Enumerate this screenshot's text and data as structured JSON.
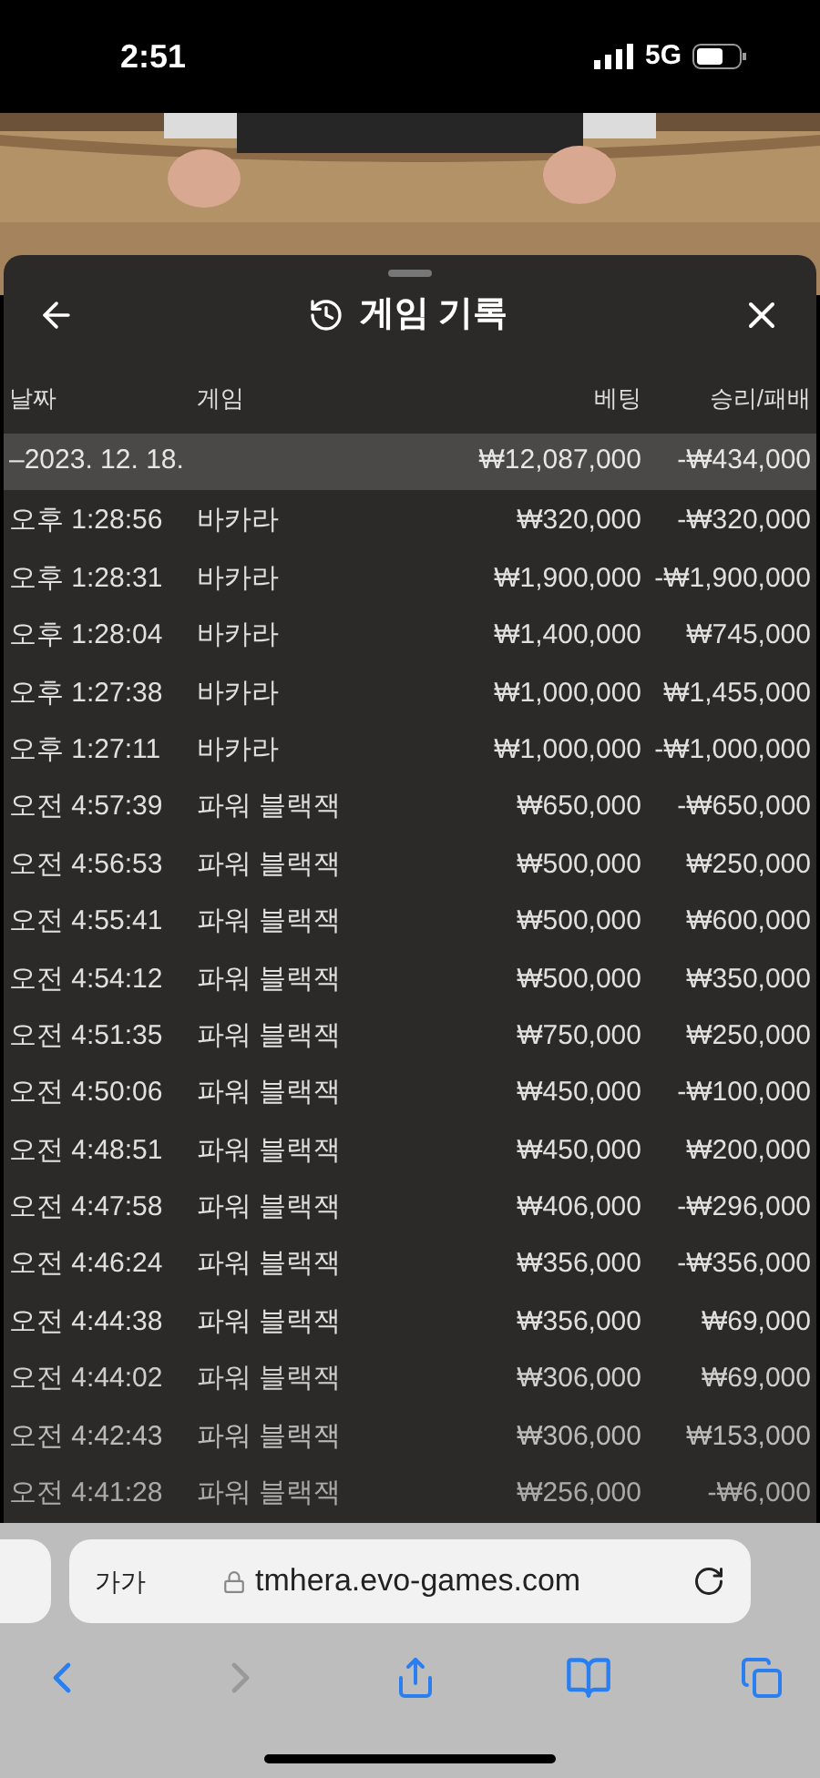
{
  "status_bar": {
    "time": "2:51",
    "network": "5G"
  },
  "sheet": {
    "title": "게임 기록"
  },
  "table": {
    "columns": [
      "날짜",
      "게임",
      "베팅",
      "승리/패배"
    ],
    "summary": {
      "date": "–2023. 12. 18.",
      "bet": "₩12,087,000",
      "result": "-₩434,000"
    },
    "rows": [
      {
        "time": "오후 1:28:56",
        "game": "바카라",
        "bet": "₩320,000",
        "result": "-₩320,000"
      },
      {
        "time": "오후 1:28:31",
        "game": "바카라",
        "bet": "₩1,900,000",
        "result": "-₩1,900,000"
      },
      {
        "time": "오후 1:28:04",
        "game": "바카라",
        "bet": "₩1,400,000",
        "result": "₩745,000"
      },
      {
        "time": "오후 1:27:38",
        "game": "바카라",
        "bet": "₩1,000,000",
        "result": "₩1,455,000"
      },
      {
        "time": "오후 1:27:11",
        "game": "바카라",
        "bet": "₩1,000,000",
        "result": "-₩1,000,000"
      },
      {
        "time": "오전 4:57:39",
        "game": "파워 블랙잭",
        "bet": "₩650,000",
        "result": "-₩650,000"
      },
      {
        "time": "오전 4:56:53",
        "game": "파워 블랙잭",
        "bet": "₩500,000",
        "result": "₩250,000"
      },
      {
        "time": "오전 4:55:41",
        "game": "파워 블랙잭",
        "bet": "₩500,000",
        "result": "₩600,000"
      },
      {
        "time": "오전 4:54:12",
        "game": "파워 블랙잭",
        "bet": "₩500,000",
        "result": "₩350,000"
      },
      {
        "time": "오전 4:51:35",
        "game": "파워 블랙잭",
        "bet": "₩750,000",
        "result": "₩250,000"
      },
      {
        "time": "오전 4:50:06",
        "game": "파워 블랙잭",
        "bet": "₩450,000",
        "result": "-₩100,000"
      },
      {
        "time": "오전 4:48:51",
        "game": "파워 블랙잭",
        "bet": "₩450,000",
        "result": "₩200,000"
      },
      {
        "time": "오전 4:47:58",
        "game": "파워 블랙잭",
        "bet": "₩406,000",
        "result": "-₩296,000"
      },
      {
        "time": "오전 4:46:24",
        "game": "파워 블랙잭",
        "bet": "₩356,000",
        "result": "-₩356,000"
      },
      {
        "time": "오전 4:44:38",
        "game": "파워 블랙잭",
        "bet": "₩356,000",
        "result": "₩69,000"
      },
      {
        "time": "오전 4:44:02",
        "game": "파워 블랙잭",
        "bet": "₩306,000",
        "result": "₩69,000"
      },
      {
        "time": "오전 4:42:43",
        "game": "파워 블랙잭",
        "bet": "₩306,000",
        "result": "₩153,000"
      },
      {
        "time": "오전 4:41:28",
        "game": "파워 블랙잭",
        "bet": "₩256,000",
        "result": "-₩6,000"
      }
    ]
  },
  "browser": {
    "text_size": "가가",
    "url": "tmhera.evo-games.com"
  }
}
